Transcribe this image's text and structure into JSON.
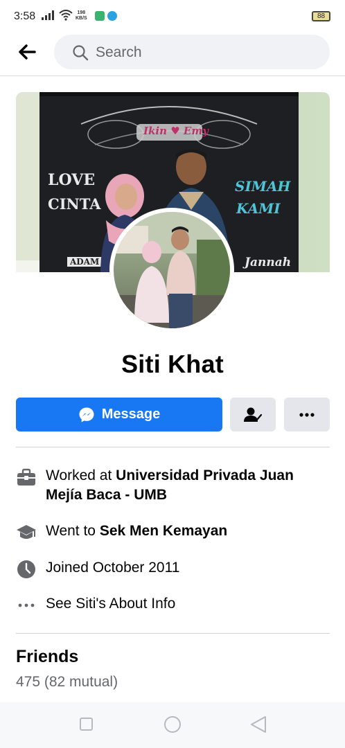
{
  "status_bar": {
    "time": "3:58",
    "speed_value": "198",
    "speed_unit": "KB/S",
    "battery": "88"
  },
  "topbar": {
    "back_icon": "arrow-left-icon",
    "search_placeholder": "Search"
  },
  "cover": {
    "banner_heading": "Ikin ♥ Emy",
    "banner_left_word1": "LOVE",
    "banner_left_word2": "CINTA",
    "banner_right_word1": "SIMAH",
    "banner_right_word2": "KAMI",
    "banner_bottom_left": "ADAM",
    "banner_bottom_right": "Jannah"
  },
  "profile": {
    "name": "Siti Khat"
  },
  "actions": {
    "message_label": "Message",
    "friend_icon": "friend-status-icon",
    "more_icon": "more-dots-icon"
  },
  "info": {
    "work_prefix": "Worked at ",
    "work_place": "Universidad Privada Juan Mejía Baca - UMB",
    "education_prefix": "Went to ",
    "education_place": "Sek Men Kemayan",
    "joined": "Joined October 2011",
    "about_link": "See Siti's About Info"
  },
  "friends": {
    "title": "Friends",
    "count": "475 (82 mutual)"
  },
  "colors": {
    "primary": "#1877f2",
    "secondary_button": "#e4e6eb",
    "text_primary": "#050505",
    "text_secondary": "#65676b"
  }
}
